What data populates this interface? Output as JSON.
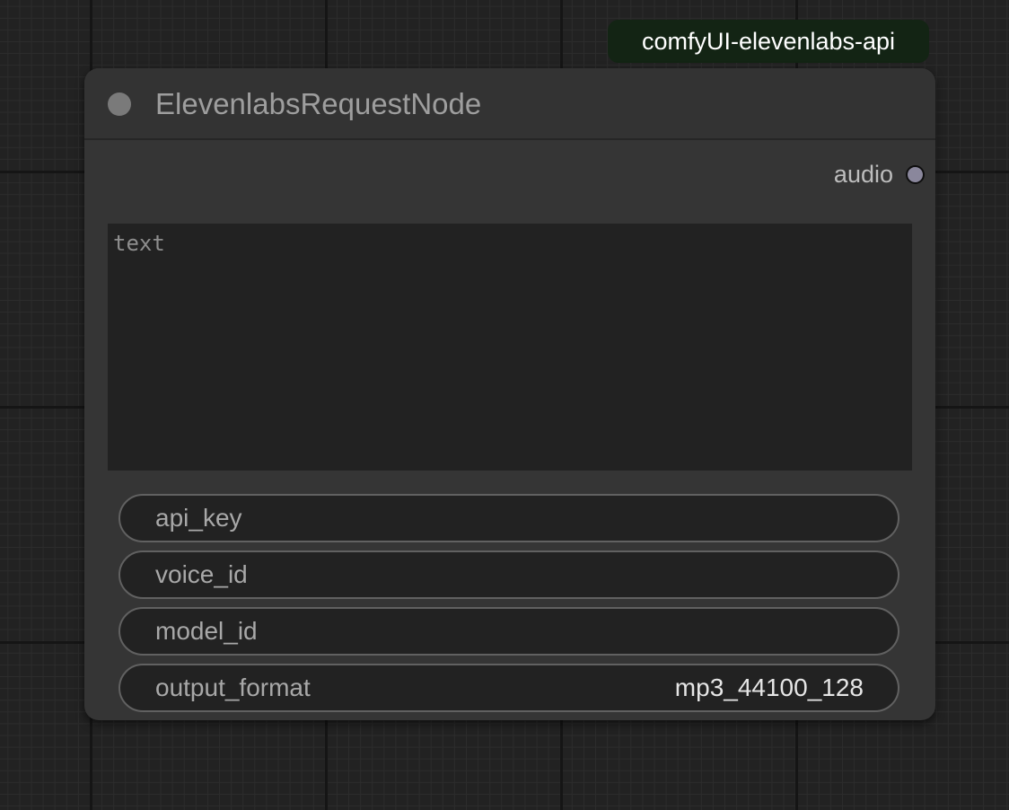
{
  "badge": {
    "label": "comfyUI-elevenlabs-api",
    "color": "#132414"
  },
  "node": {
    "title": "ElevenlabsRequestNode",
    "status_icon": "status-dot-icon",
    "outputs": [
      {
        "label": "audio",
        "slot_color": "#8a879c"
      }
    ],
    "text_area": {
      "placeholder": "text",
      "value": ""
    },
    "widgets": [
      {
        "label": "api_key",
        "value": ""
      },
      {
        "label": "voice_id",
        "value": ""
      },
      {
        "label": "model_id",
        "value": ""
      },
      {
        "label": "output_format",
        "value": "mp3_44100_128"
      }
    ]
  }
}
